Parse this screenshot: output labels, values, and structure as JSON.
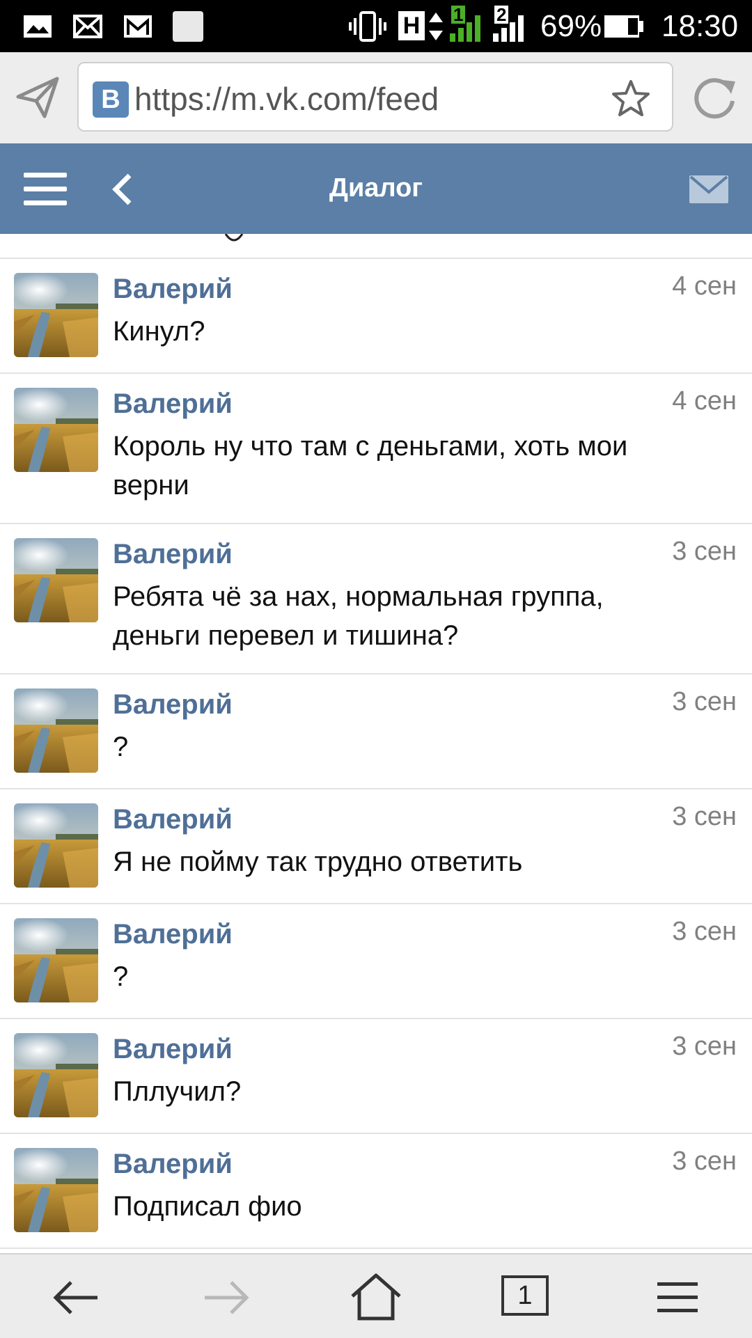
{
  "status_bar": {
    "battery": "69%",
    "time": "18:30",
    "network_type": "H",
    "sim1": "1",
    "sim2": "2"
  },
  "browser": {
    "url": "https://m.vk.com/feed",
    "site_badge": "В",
    "tab_count": "1"
  },
  "header": {
    "title": "Диалог"
  },
  "messages": [
    {
      "sender": "Валерий",
      "date": "4 сен",
      "text": "Кинул?"
    },
    {
      "sender": "Валерий",
      "date": "4 сен",
      "text": "Король ну что там с деньгами, хоть мои верни"
    },
    {
      "sender": "Валерий",
      "date": "3 сен",
      "text": "Ребята чё за нах, нормальная группа, деньги перевел и тишина?"
    },
    {
      "sender": "Валерий",
      "date": "3 сен",
      "text": "?"
    },
    {
      "sender": "Валерий",
      "date": "3 сен",
      "text": "Я не пойму так трудно ответить"
    },
    {
      "sender": "Валерий",
      "date": "3 сен",
      "text": "?"
    },
    {
      "sender": "Валерий",
      "date": "3 сен",
      "text": "Пллучил?"
    },
    {
      "sender": "Валерий",
      "date": "3 сен",
      "text": "Подписал фио"
    }
  ],
  "colors": {
    "header_bg": "#5b7fa6",
    "sender_name": "#4f6f97",
    "date_text": "#808080",
    "signal_green": "#4caf28"
  }
}
